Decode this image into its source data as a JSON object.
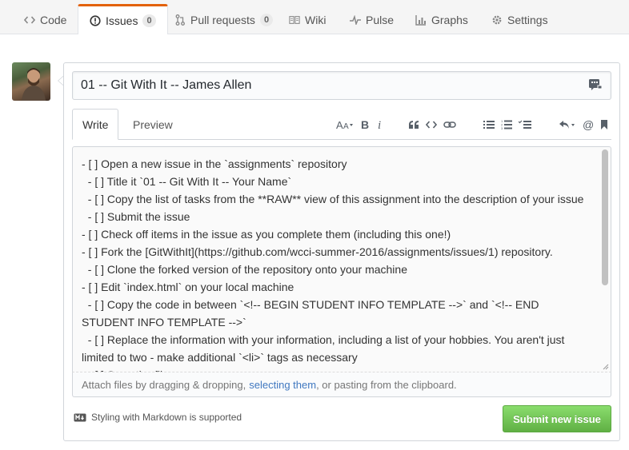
{
  "tabs": [
    {
      "label": "Code",
      "icon": "code-icon"
    },
    {
      "label": "Issues",
      "icon": "issue-opened-icon",
      "count": "0",
      "selected": true
    },
    {
      "label": "Pull requests",
      "icon": "pull-request-icon",
      "count": "0"
    },
    {
      "label": "Wiki",
      "icon": "book-icon"
    },
    {
      "label": "Pulse",
      "icon": "pulse-icon"
    },
    {
      "label": "Graphs",
      "icon": "graph-icon"
    },
    {
      "label": "Settings",
      "icon": "gear-icon"
    }
  ],
  "issue": {
    "title_value": "01 -- Git With It -- James Allen",
    "write_tab": "Write",
    "preview_tab": "Preview",
    "body": "- [ ] Open a new issue in the `assignments` repository\n  - [ ] Title it `01 -- Git With It -- Your Name`\n  - [ ] Copy the list of tasks from the **RAW** view of this assignment into the description of your issue\n  - [ ] Submit the issue\n- [ ] Check off items in the issue as you complete them (including this one!)\n- [ ] Fork the [GitWithIt](https://github.com/wcci-summer-2016/assignments/issues/1) repository.\n  - [ ] Clone the forked version of the repository onto your machine\n- [ ] Edit `index.html` on your local machine\n  - [ ] Copy the code in between `<!-- BEGIN STUDENT INFO TEMPLATE -->` and `<!-- END STUDENT INFO TEMPLATE -->`\n  - [ ] Replace the information with your information, including a list of your hobbies. You aren't just limited to two - make additional `<li>` tags as necessary\n  - [ ] Save the file",
    "attach_before": "Attach files by dragging & dropping, ",
    "attach_link": "selecting them",
    "attach_after": ", or pasting from the clipboard.",
    "markdown_note": "Styling with Markdown is supported",
    "submit_label": "Submit new issue"
  },
  "toolbar": {
    "icons": [
      "text-size-icon",
      "bold-icon",
      "italic-icon",
      "quote-icon",
      "code-icon",
      "link-icon",
      "unordered-list-icon",
      "ordered-list-icon",
      "task-list-icon",
      "reply-icon",
      "mention-icon",
      "bookmark-icon"
    ]
  },
  "colors": {
    "accent": "#e36209",
    "submit": "#60b044",
    "link": "#4078c0"
  }
}
